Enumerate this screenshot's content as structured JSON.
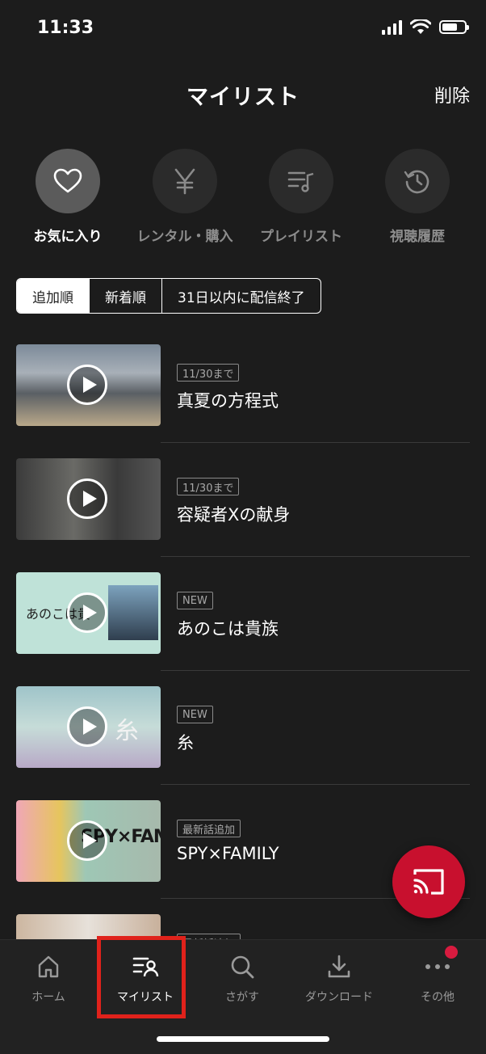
{
  "status": {
    "time": "11:33"
  },
  "header": {
    "title": "マイリスト",
    "action": "削除"
  },
  "categories": [
    {
      "label": "お気に入り",
      "icon": "heart-icon",
      "active": true
    },
    {
      "label": "レンタル・購入",
      "icon": "yen-icon",
      "active": false
    },
    {
      "label": "プレイリスト",
      "icon": "playlist-icon",
      "active": false
    },
    {
      "label": "視聴履歴",
      "icon": "history-icon",
      "active": false
    }
  ],
  "sort_tabs": [
    "追加順",
    "新着順",
    "31日以内に配信終了"
  ],
  "items": [
    {
      "badge": "11/30まで",
      "title": "真夏の方程式"
    },
    {
      "badge": "11/30まで",
      "title": "容疑者Xの献身"
    },
    {
      "badge": "NEW",
      "title": "あのこは貴族",
      "thumb_text": "あのこは貴"
    },
    {
      "badge": "NEW",
      "title": "糸",
      "thumb_text": "糸"
    },
    {
      "badge": "最新話追加",
      "title": "SPY×FAMILY",
      "thumb_text": "SPY×FAMILY"
    },
    {
      "badge": "最新話追加"
    }
  ],
  "tabbar": [
    {
      "label": "ホーム",
      "icon": "home-icon"
    },
    {
      "label": "マイリスト",
      "icon": "mylist-icon",
      "active": true
    },
    {
      "label": "さがす",
      "icon": "search-icon"
    },
    {
      "label": "ダウンロード",
      "icon": "download-icon"
    },
    {
      "label": "その他",
      "icon": "more-icon"
    }
  ],
  "colors": {
    "background": "#1c1c1c",
    "fab": "#c8102e",
    "highlight": "#e0221b",
    "notification": "#d81b3f"
  }
}
